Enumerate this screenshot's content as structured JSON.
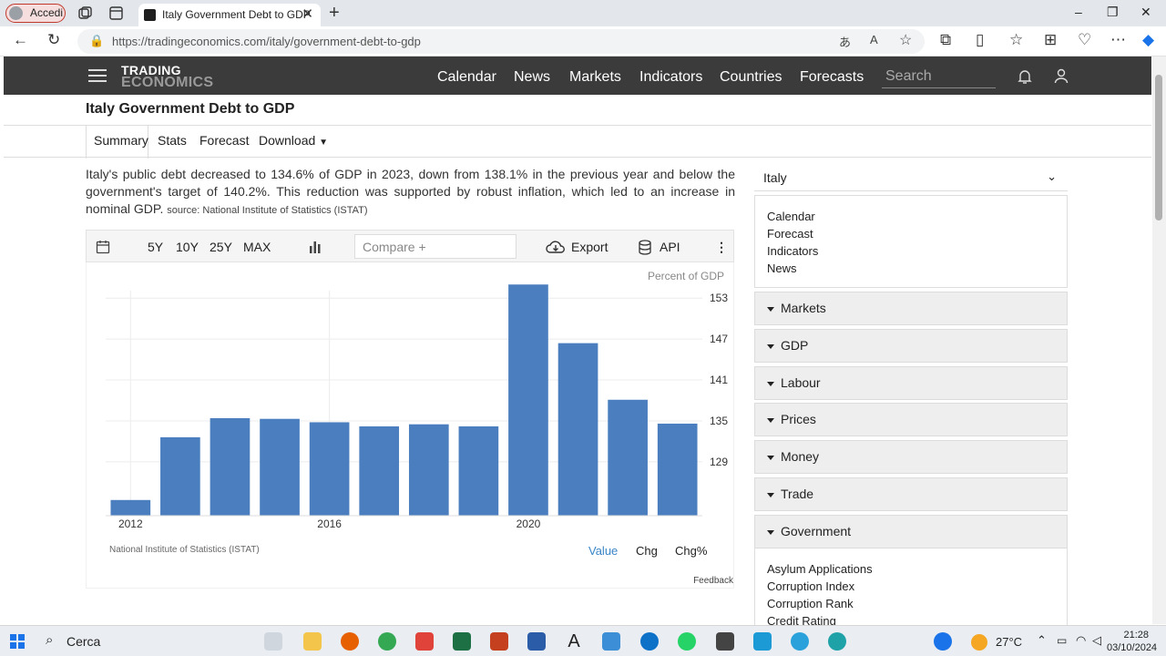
{
  "browser": {
    "profile_label": "Accedi",
    "tab_title": "Italy Government Debt to GDP",
    "url": "https://tradingeconomics.com/italy/government-debt-to-gdp",
    "window_controls": [
      "–",
      "❐",
      "✕"
    ]
  },
  "site": {
    "logo_line1": "TRADING",
    "logo_line2": "ECONOMICS",
    "nav": [
      "Calendar",
      "News",
      "Markets",
      "Indicators",
      "Countries",
      "Forecasts"
    ],
    "search_placeholder": "Search"
  },
  "page": {
    "title": "Italy Government Debt to GDP",
    "tabs": [
      "Summary",
      "Stats",
      "Forecast",
      "Download"
    ],
    "description": "Italy's public debt decreased to 134.6% of GDP in 2023, down from 138.1% in the previous year and below the government's target of 140.2%. This reduction was supported by robust inflation, which led to an increase in nominal GDP.",
    "source_label": "source: National Institute of Statistics (ISTAT)"
  },
  "chart_toolbar": {
    "ranges": [
      "5Y",
      "10Y",
      "25Y",
      "MAX"
    ],
    "compare_placeholder": "Compare +",
    "export_label": "Export",
    "api_label": "API"
  },
  "chart_footer": {
    "unit": "Percent of GDP",
    "source": "National Institute of Statistics (ISTAT)",
    "value_tabs": [
      "Value",
      "Chg",
      "Chg%"
    ],
    "feedback": "Feedback"
  },
  "chart_data": {
    "type": "bar",
    "title": "",
    "xlabel": "",
    "ylabel": "Percent of GDP",
    "categories": [
      "2012",
      "2013",
      "2014",
      "2015",
      "2016",
      "2017",
      "2018",
      "2019",
      "2020",
      "2021",
      "2022",
      "2023"
    ],
    "values": [
      123.4,
      132.6,
      135.4,
      135.3,
      134.8,
      134.2,
      134.5,
      134.2,
      155.0,
      146.4,
      138.1,
      134.6
    ],
    "x_tick_labels": [
      "2012",
      "2016",
      "2020"
    ],
    "y_ticks": [
      129,
      135,
      141,
      147,
      153
    ],
    "ylim": [
      121.1,
      154.1
    ],
    "grid": true,
    "bar_color": "#4a7ebf",
    "axis_side": "right"
  },
  "sidebar": {
    "country": "Italy",
    "links": [
      "Calendar",
      "Forecast",
      "Indicators",
      "News"
    ],
    "sections": [
      "Markets",
      "GDP",
      "Labour",
      "Prices",
      "Money",
      "Trade",
      "Government"
    ],
    "government_items": [
      "Asylum Applications",
      "Corruption Index",
      "Corruption Rank",
      "Credit Rating"
    ]
  },
  "taskbar": {
    "search_label": "Cerca",
    "temperature": "27°C",
    "time": "21:28",
    "date": "03/10/2024"
  }
}
